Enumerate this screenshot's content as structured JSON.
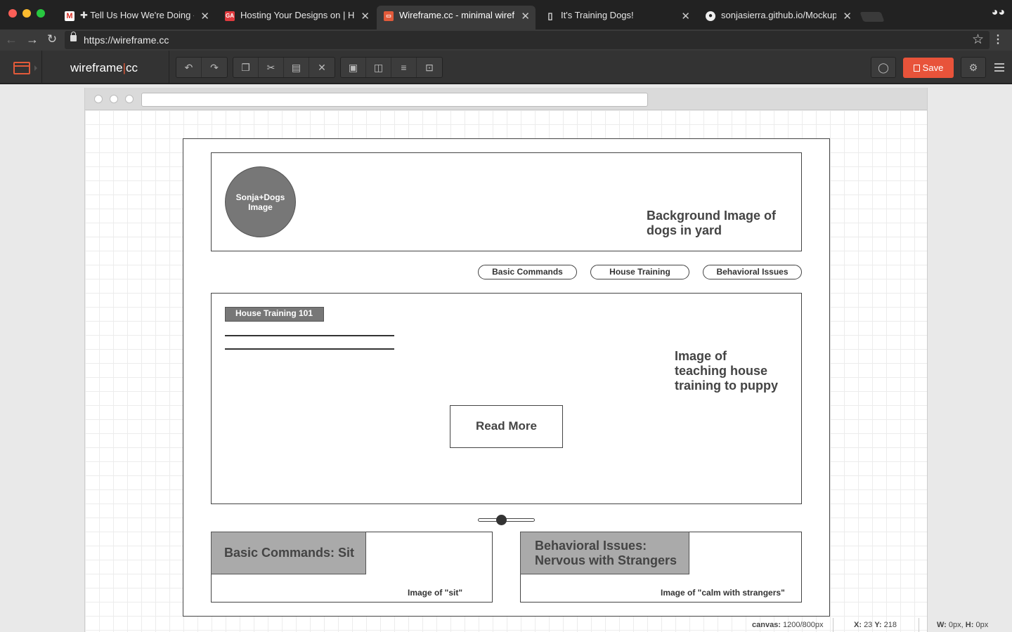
{
  "browser": {
    "tabs": [
      {
        "title": "✚ Tell Us How We're Doing - sc",
        "favicon": "gmail-icon"
      },
      {
        "title": "Hosting Your Designs on | HTML",
        "favicon": "ga-icon"
      },
      {
        "title": "Wireframe.cc - minimal wirefra",
        "favicon": "wireframe-icon",
        "active": true
      },
      {
        "title": "It's Training Dogs!",
        "favicon": "document-icon"
      },
      {
        "title": "sonjasierra.github.io/Mockup_v",
        "favicon": "github-icon"
      }
    ],
    "url": "https://wireframe.cc"
  },
  "app": {
    "brand_left": "wireframe",
    "brand_sep": "|",
    "brand_right": "cc",
    "save_label": "Save",
    "toolbar_groups": [
      [
        "undo-icon",
        "redo-icon"
      ],
      [
        "duplicate-icon",
        "cut-icon",
        "paste-icon",
        "delete-icon"
      ],
      [
        "lock-icon",
        "send-back-icon",
        "align-icon",
        "group-icon"
      ]
    ]
  },
  "wireframe": {
    "header_circle": "Sonja+Dogs Image",
    "header_bg_text": "Background Image of dogs in yard",
    "nav": [
      "Basic Commands",
      "House Training",
      "Behavioral Issues"
    ],
    "feature_tag": "House Training 101",
    "feature_image_text": "Image of teaching house training to puppy",
    "read_more": "Read More",
    "slider_value": 0.4,
    "card1_title": "Basic Commands: Sit",
    "card1_caption": "Image of \"sit\"",
    "card2_title": "Behavioral Issues: Nervous with Strangers",
    "card2_caption": "Image of \"calm with strangers\""
  },
  "status": {
    "canvas_label": "canvas:",
    "canvas_value": "1200/800px",
    "x_label": "X:",
    "x_value": "23",
    "y_label": "Y:",
    "y_value": "218",
    "w_label": "W:",
    "w_value": "0px,",
    "h_label": "H:",
    "h_value": "0px"
  },
  "colors": {
    "accent": "#e8533a",
    "toolbar": "#333333",
    "wireframe_fill": "#777777"
  }
}
